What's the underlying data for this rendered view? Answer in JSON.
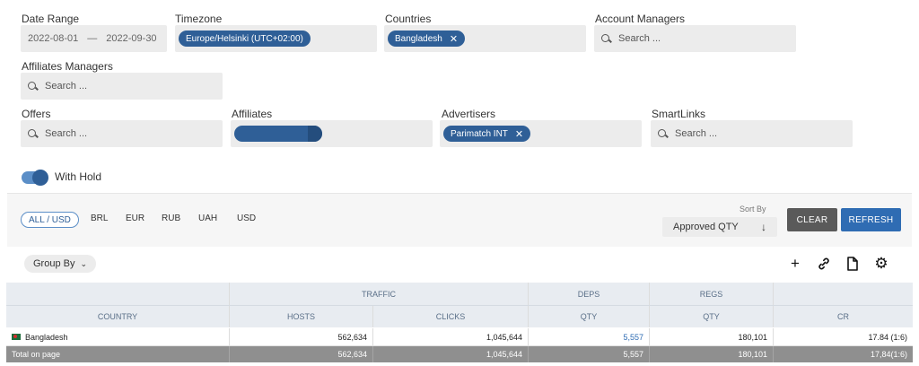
{
  "filters": {
    "date_range": {
      "label": "Date Range",
      "from": "2022-08-01",
      "sep": "—",
      "to": "2022-09-30"
    },
    "timezone": {
      "label": "Timezone",
      "chip": "Europe/Helsinki (UTC+02:00)"
    },
    "countries": {
      "label": "Countries",
      "chip": "Bangladesh",
      "chip_close": "✕"
    },
    "account_managers": {
      "label": "Account Managers",
      "placeholder": "Search ..."
    },
    "affiliates_managers": {
      "label": "Affiliates Managers",
      "placeholder": "Search ..."
    },
    "offers": {
      "label": "Offers",
      "placeholder": "Search ..."
    },
    "affiliates": {
      "label": "Affiliates"
    },
    "advertisers": {
      "label": "Advertisers",
      "chip": "Parimatch INT",
      "chip_close": "✕"
    },
    "smartlinks": {
      "label": "SmartLinks",
      "placeholder": "Search ..."
    },
    "with_hold": {
      "label": "With Hold",
      "enabled": true
    }
  },
  "currency": {
    "active": "ALL / USD",
    "options": [
      "BRL",
      "EUR",
      "RUB",
      "UAH",
      "USD"
    ]
  },
  "sort": {
    "label": "Sort By",
    "value": "Approved QTY",
    "direction_icon": "arrow-down-icon"
  },
  "buttons": {
    "clear": "CLEAR",
    "refresh": "REFRESH"
  },
  "group_by": {
    "label": "Group By"
  },
  "toolbar_icons": [
    "plus-icon",
    "link-icon",
    "file-icon",
    "gear-icon"
  ],
  "table": {
    "group_headers": [
      "",
      "TRAFFIC",
      "DEPS",
      "REGS",
      ""
    ],
    "columns": [
      "COUNTRY",
      "HOSTS",
      "CLICKS",
      "QTY",
      "QTY",
      "CR"
    ],
    "rows": [
      {
        "country": "Bangladesh",
        "hosts": "562,634",
        "clicks": "1,045,644",
        "deps_qty": "5,557",
        "regs_qty": "180,101",
        "cr": "17.84 (1:6)"
      }
    ],
    "total": {
      "label": "Total on page",
      "hosts": "562,634",
      "clicks": "1,045,644",
      "deps_qty": "5,557",
      "regs_qty": "180,101",
      "cr": "17,84(1:6)"
    }
  },
  "colors": {
    "accent": "#2f5f97",
    "refresh": "#2f6cb3",
    "clear": "#5a5a5a",
    "header_bg": "#e8ecf1",
    "total_bg": "#8f8f8f"
  }
}
